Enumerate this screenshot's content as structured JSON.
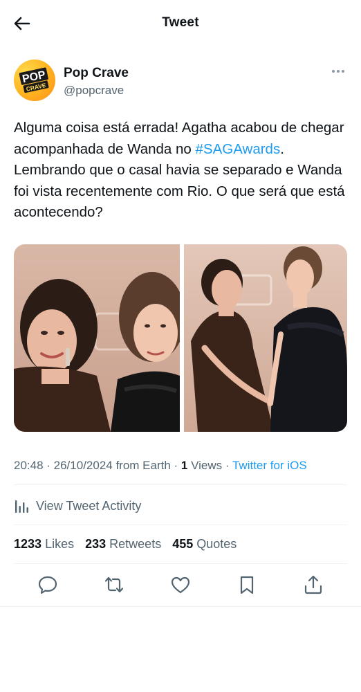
{
  "header": {
    "title": "Tweet",
    "back_icon": "arrow-left-icon"
  },
  "author": {
    "display_name": "Pop Crave",
    "handle": "@popcrave",
    "avatar_text_top": "POP",
    "avatar_text_bottom": "CRAVE",
    "avatar_color": "#ffb21f"
  },
  "tweet": {
    "text_before": "Alguma coisa está errada! Agatha acabou de chegar acompanhada de Wanda no ",
    "hashtag": "#SAGAwards",
    "text_after": ". Lembrando que o casal havia se separado e Wanda foi vista recentemente com Rio. O que será que está acontecendo?"
  },
  "meta": {
    "timestamp": "20:48 · 26/10/2024 from Earth · ",
    "views_count": "1",
    "views_label": " Views · ",
    "source": "Twitter for iOS"
  },
  "activity": {
    "label": "View Tweet Activity",
    "icon": "analytics-icon"
  },
  "stats": {
    "likes_count": "1233",
    "likes_label": "Likes",
    "retweets_count": "233",
    "retweets_label": "Retweets",
    "quotes_count": "455",
    "quotes_label": "Quotes"
  },
  "actions": [
    "reply-icon",
    "retweet-icon",
    "like-icon",
    "bookmark-icon",
    "share-icon"
  ],
  "colors": {
    "link": "#1d9bf0",
    "secondary_text": "#536471",
    "primary_text": "#0f1419",
    "divider": "#eff3f4"
  }
}
